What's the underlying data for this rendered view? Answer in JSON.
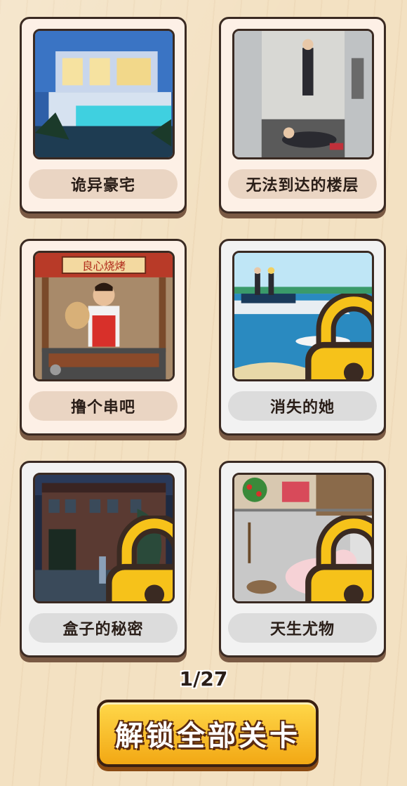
{
  "levels": [
    {
      "title": "诡异豪宅",
      "locked": false,
      "scene": "mansion"
    },
    {
      "title": "无法到达的楼层",
      "locked": false,
      "scene": "elevator"
    },
    {
      "title": "撸个串吧",
      "locked": false,
      "scene": "bbq",
      "sign": "良心烧烤"
    },
    {
      "title": "消失的她",
      "locked": true,
      "scene": "boat",
      "lock_icon": "padlock-icon"
    },
    {
      "title": "盒子的秘密",
      "locked": true,
      "scene": "house",
      "lock_icon": "padlock-icon"
    },
    {
      "title": "天生尤物",
      "locked": true,
      "scene": "pig",
      "lock_icon": "padlock-icon"
    }
  ],
  "pagination": {
    "text": "1/27"
  },
  "unlock_button": {
    "label": "解锁全部关卡"
  },
  "colors": {
    "accent": "#f2a814",
    "outline": "#3a2a22",
    "background": "#f3e1c2"
  }
}
